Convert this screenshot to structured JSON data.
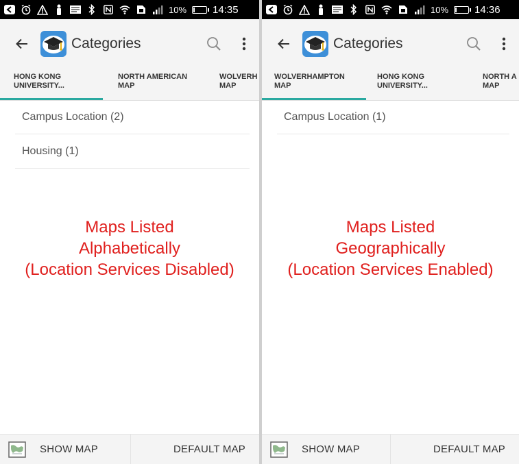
{
  "screens": [
    {
      "status": {
        "battery_pct": "10%",
        "battery_level": 0.1,
        "time": "14:35"
      },
      "app": {
        "title": "Categories"
      },
      "tabs": [
        {
          "line1": "HONG KONG",
          "line2": "UNIVERSITY...",
          "active": true
        },
        {
          "line1": "NORTH AMERICAN",
          "line2": "MAP",
          "active": false
        },
        {
          "line1": "WOLVERH",
          "line2": "MAP",
          "active": false
        }
      ],
      "list": [
        "Campus Location (2)",
        "Housing (1)"
      ],
      "caption": [
        "Maps Listed",
        "Alphabetically",
        "(Location Services Disabled)"
      ],
      "bottom": {
        "show_map": "SHOW MAP",
        "default_map": "DEFAULT MAP"
      }
    },
    {
      "status": {
        "battery_pct": "10%",
        "battery_level": 0.1,
        "time": "14:36"
      },
      "app": {
        "title": "Categories"
      },
      "tabs": [
        {
          "line1": "WOLVERHAMPTON",
          "line2": "MAP",
          "active": true
        },
        {
          "line1": "HONG KONG",
          "line2": "UNIVERSITY...",
          "active": false
        },
        {
          "line1": "NORTH A",
          "line2": "MAP",
          "active": false
        }
      ],
      "list": [
        "Campus Location (1)"
      ],
      "caption": [
        "Maps Listed",
        "Geographically",
        "(Location Services Enabled)"
      ],
      "bottom": {
        "show_map": "SHOW MAP",
        "default_map": "DEFAULT MAP"
      }
    }
  ],
  "colors": {
    "accent": "#2aa9a0",
    "caption": "#e0201e",
    "appbar_bg": "#f4f4f4",
    "statusbar_bg": "#000000"
  },
  "icons": {
    "statusbar": [
      "back-arrow-icon",
      "alarm-icon",
      "warning-icon",
      "person-icon",
      "message-icon",
      "bluetooth-icon",
      "nfc-icon",
      "wifi-icon",
      "sim-icon",
      "signal-icon",
      "battery-icon"
    ],
    "appbar": [
      "back-icon",
      "graduation-cap-logo-icon",
      "search-icon",
      "more-vert-icon"
    ],
    "bottom": [
      "map-icon"
    ]
  }
}
